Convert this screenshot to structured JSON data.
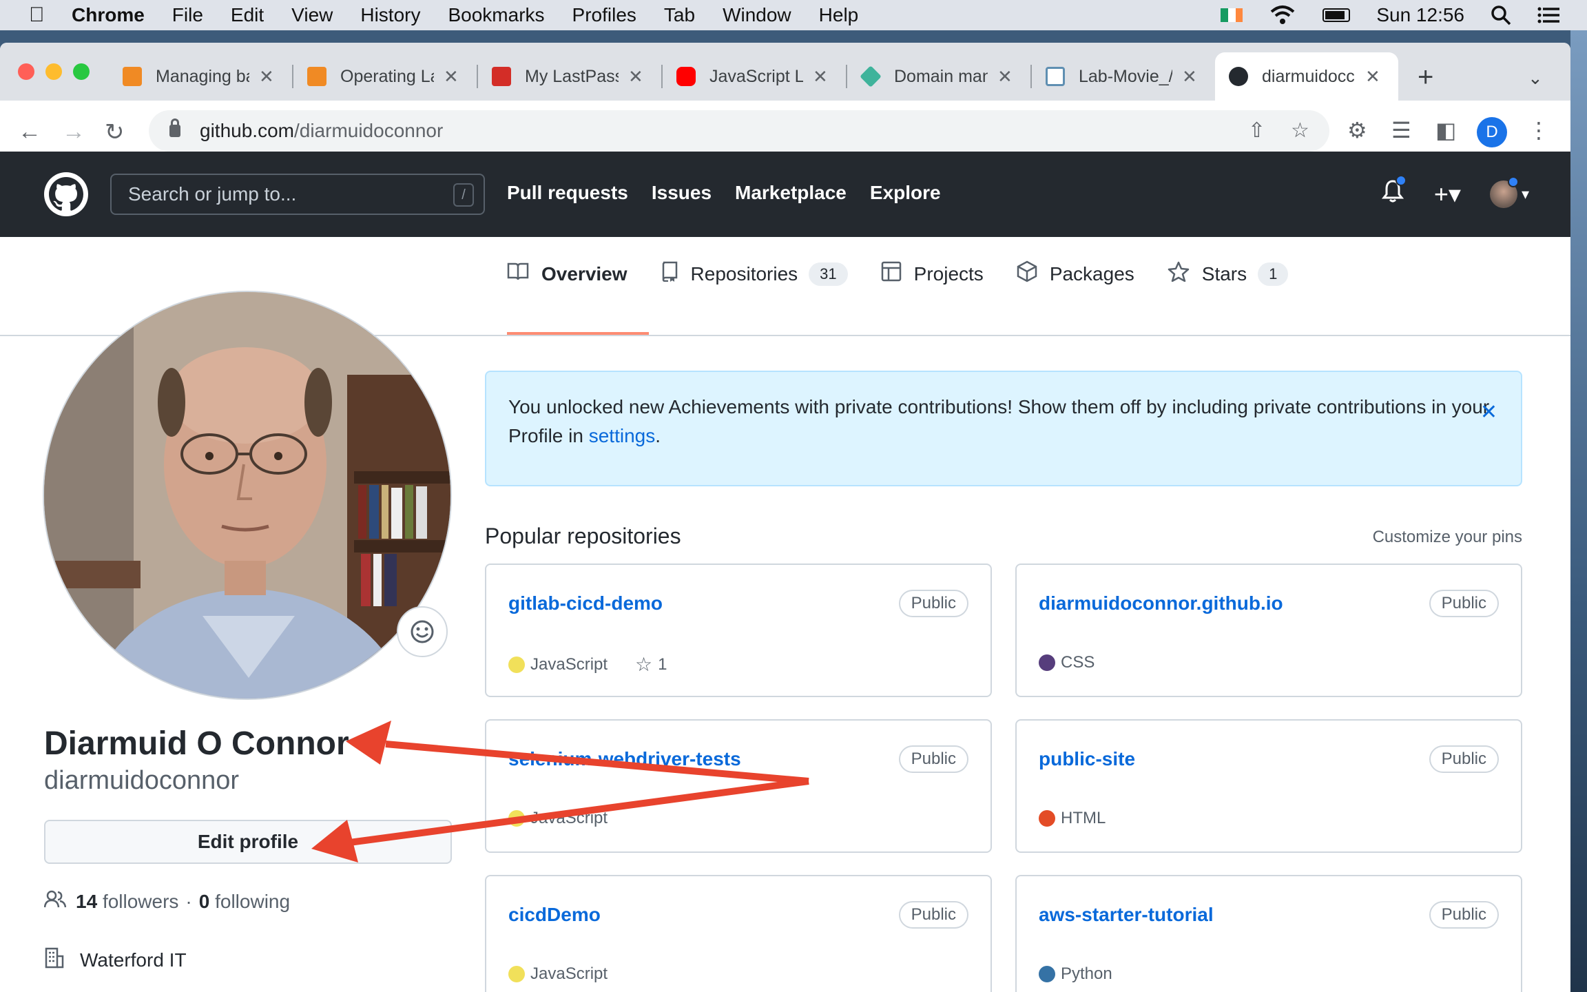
{
  "menubar": {
    "app": "Chrome",
    "items": [
      "File",
      "Edit",
      "View",
      "History",
      "Bookmarks",
      "Profiles",
      "Tab",
      "Window",
      "Help"
    ],
    "clock": "Sun 12:56"
  },
  "tabs": [
    {
      "title": "Managing ba",
      "favicon_color": "#f08a24"
    },
    {
      "title": "Operating La",
      "favicon_color": "#f08a24"
    },
    {
      "title": "My LastPass",
      "favicon_color": "#d32d27"
    },
    {
      "title": "JavaScript L",
      "favicon_color": "#ff0000"
    },
    {
      "title": "Domain man",
      "favicon_color": "#3fb39b"
    },
    {
      "title": "Lab-Movie_/",
      "favicon_color": "#5f8fb2"
    },
    {
      "title": "diarmuidocc",
      "favicon_color": "#24292f",
      "active": true
    }
  ],
  "omnibox": {
    "host": "github.com",
    "path": "/diarmuidoconnor"
  },
  "browser_profile_initial": "D",
  "github": {
    "search_placeholder": "Search or jump to...",
    "search_shortcut": "/",
    "nav": [
      "Pull requests",
      "Issues",
      "Marketplace",
      "Explore"
    ]
  },
  "profile_tabs": [
    {
      "label": "Overview",
      "icon": "book-icon",
      "active": true
    },
    {
      "label": "Repositories",
      "icon": "repo-icon",
      "count": "31"
    },
    {
      "label": "Projects",
      "icon": "table-icon"
    },
    {
      "label": "Packages",
      "icon": "package-icon"
    },
    {
      "label": "Stars",
      "icon": "star-icon",
      "count": "1"
    }
  ],
  "profile": {
    "fullname": "Diarmuid O Connor",
    "username": "diarmuidoconnor",
    "edit_label": "Edit profile",
    "followers_count": "14",
    "followers_label": "followers",
    "separator": "·",
    "following_count": "0",
    "following_label": "following",
    "organization": "Waterford IT"
  },
  "banner": {
    "text": "You unlocked new Achievements with private contributions! Show them off by including private contributions in your Profile in ",
    "link": "settings",
    "end": "."
  },
  "popular": {
    "title": "Popular repositories",
    "customize": "Customize your pins",
    "repos": [
      {
        "name": "gitlab-cicd-demo",
        "visibility": "Public",
        "language": "JavaScript",
        "lang_color": "#f1e05a",
        "stars": "1"
      },
      {
        "name": "diarmuidoconnor.github.io",
        "visibility": "Public",
        "language": "CSS",
        "lang_color": "#563d7c"
      },
      {
        "name": "selenium-webdriver-tests",
        "visibility": "Public",
        "language": "JavaScript",
        "lang_color": "#f1e05a"
      },
      {
        "name": "public-site",
        "visibility": "Public",
        "language": "HTML",
        "lang_color": "#e34c26"
      },
      {
        "name": "cicdDemo",
        "visibility": "Public",
        "language": "JavaScript",
        "lang_color": "#f1e05a"
      },
      {
        "name": "aws-starter-tutorial",
        "visibility": "Public",
        "language": "Python",
        "lang_color": "#3572A5"
      }
    ]
  },
  "colors": {
    "accent_link": "#0969da",
    "annotation_arrow": "#e8432d",
    "active_tab_underline": "#fd8c73"
  }
}
